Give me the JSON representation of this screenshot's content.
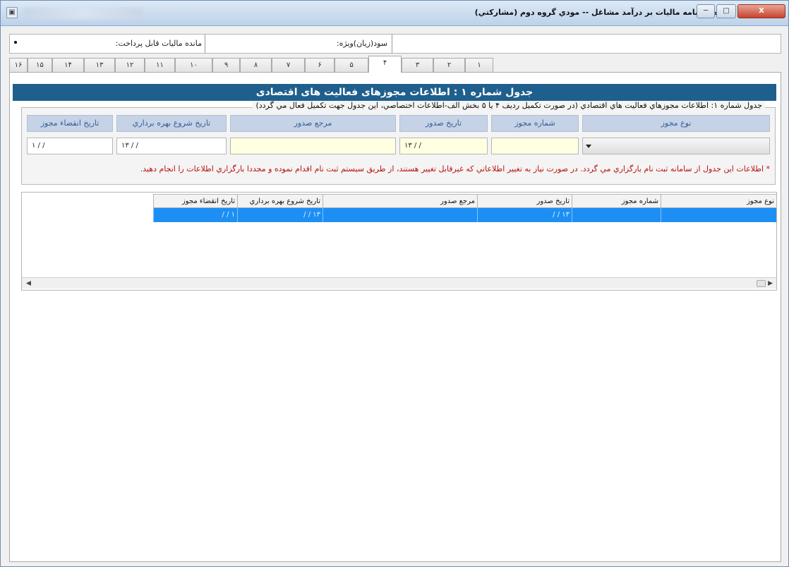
{
  "window": {
    "title": "اظهارنامه ماليات بر درآمد مشاغل -- مودي گروه دوم (مشاركتي)",
    "app_icon": "document-icon",
    "buttons": {
      "minimize": "─",
      "maximize": "□",
      "close": "X"
    },
    "colors": {
      "title_bg": "#bcd2ea",
      "close_bg": "#c8432d"
    }
  },
  "summary": {
    "profit_label": "سود(زيان)ويژه:",
    "remaining_tax_label": "مانده ماليات قابل پرداخت:"
  },
  "tabs": {
    "items": [
      "۱",
      "۲",
      "۳",
      "۴",
      "۵",
      "۶",
      "۷",
      "۸",
      "۹",
      "۱۰",
      "۱۱",
      "۱۲",
      "۱۳",
      "۱۴",
      "۱۵",
      "۱۶"
    ],
    "active": "۴"
  },
  "section": {
    "title": "جدول شماره ۱ : اطلاعات مجوزهای فعالیت های اقتصادی",
    "group_label": "جدول شماره ۱: اطلاعات مجوزهاي فعاليت هاي اقتصادي  (در صورت تكميل رديف ۴ يا ۵ بخش الف-اطلاعات اختصاصي، اين جدول جهت تكميل فعال مي گردد)",
    "headers": {
      "license_type": "نوع مجوز",
      "license_number": "شماره مجوز",
      "issue_date": "تاريخ صدور",
      "issuer": "مرجع صدور",
      "operation_start_date": "تاريخ شروع بهره برداري",
      "expiry_date": "تاريخ انقضاء مجوز"
    },
    "values": {
      "license_type": "",
      "license_number": "",
      "issue_date": "۱۳ / /",
      "issuer": "",
      "operation_start_date": "۱۳ / /",
      "expiry_date": "۱ / /"
    },
    "warning": "* اطلاعات اين جدول از سامانه ثبت نام بارگزاري مي گردد. در صورت نياز به تغيير اطلاعاتي كه غيرقابل تغيير هستند، از طريق سيستم ثبت نام اقدام نموده و مجددا بارگزاري اطلاعات را انجام دهيد."
  },
  "grid": {
    "columns": [
      "نوع مجوز",
      "شماره مجوز",
      "تاريخ صدور",
      "مرجع صدور",
      "تاريخ شروع بهره برداري",
      "تاريخ انقضاء مجوز"
    ],
    "rows": [
      [
        "",
        "",
        "/ / ۱۳",
        "",
        "/ / ۱۳",
        "/ / ۱"
      ]
    ],
    "selected_row_color": "#1d8ff4"
  }
}
